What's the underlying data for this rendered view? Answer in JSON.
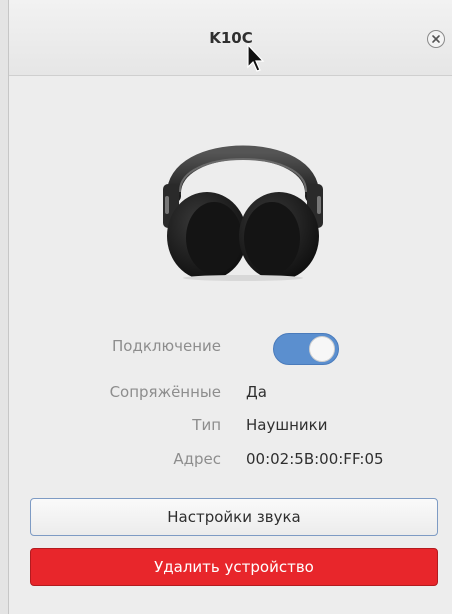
{
  "window": {
    "title": "K10C"
  },
  "device": {
    "image": "headphones-icon"
  },
  "properties": {
    "connection_label": "Подключение",
    "connection_on": true,
    "paired_label": "Сопряжённые",
    "paired_value": "Да",
    "type_label": "Тип",
    "type_value": "Наушники",
    "address_label": "Адрес",
    "address_value": "00:02:5B:00:FF:05"
  },
  "actions": {
    "sound_settings_label": "Настройки звука",
    "remove_device_label": "Удалить устройство"
  },
  "colors": {
    "toggle_on": "#5b8fcf",
    "danger": "#e8262b"
  }
}
